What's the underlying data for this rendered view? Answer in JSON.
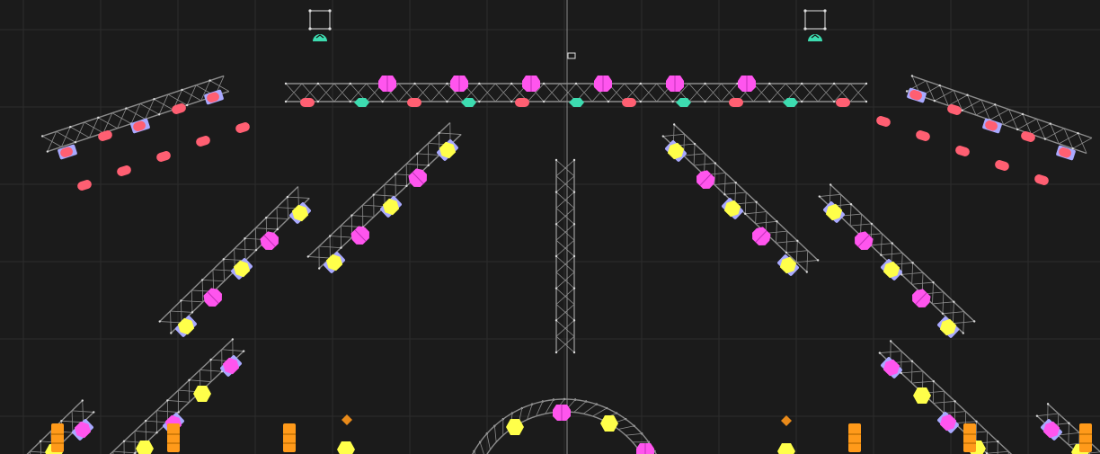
{
  "view": {
    "name": "lighting-plot-top-view",
    "colors": {
      "background": "#1b1b1b",
      "grid": "#2c2c2c",
      "centerline": "#8a8a8a",
      "truss": "#8c8c8c",
      "wash_fixture": "#ff5f72",
      "spot_fixture": "#ff55ee",
      "beam_fixture": "#ffff4a",
      "fixture_body": "#a9a9ff",
      "cyan_fixture": "#3ddcb0",
      "strobe_fixture": "#ff9a1a"
    }
  }
}
